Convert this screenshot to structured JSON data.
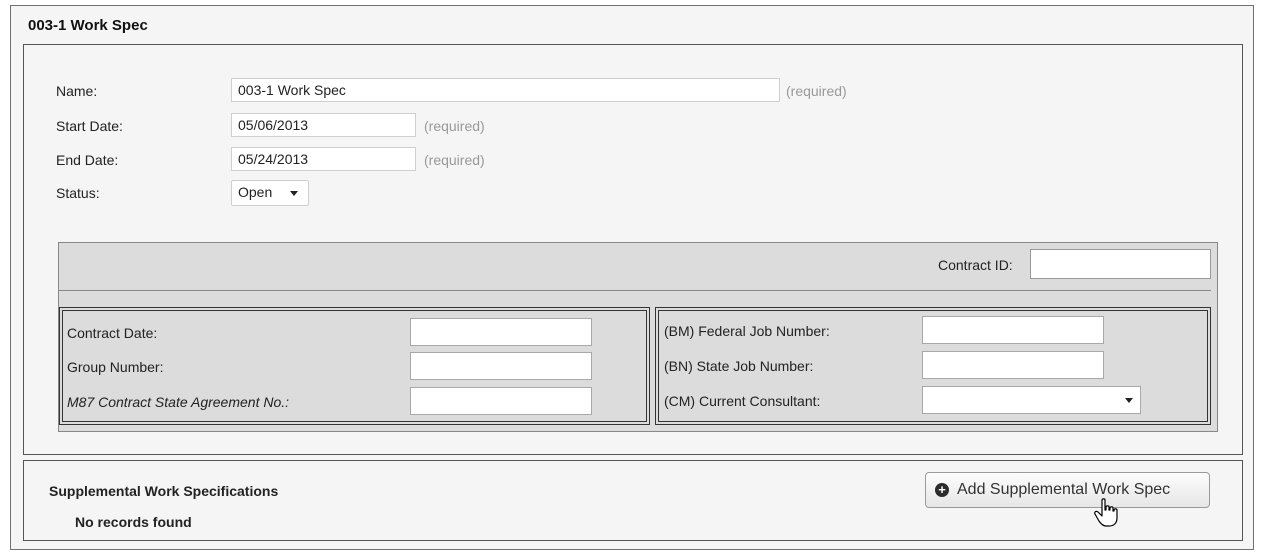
{
  "form": {
    "title": "003-1 Work Spec",
    "name_label": "Name:",
    "name_value": "003-1 Work Spec",
    "name_required": "(required)",
    "start_date_label": "Start Date:",
    "start_date_value": "05/06/2013",
    "start_date_required": "(required)",
    "end_date_label": "End Date:",
    "end_date_value": "05/24/2013",
    "end_date_required": "(required)",
    "status_label": "Status:",
    "status_value": "Open"
  },
  "contract": {
    "contract_id_label": "Contract ID:",
    "contract_id_value": "",
    "left": {
      "contract_date_label": "Contract Date:",
      "group_number_label": "Group Number:",
      "m87_label": "M87 Contract State Agreement No.:"
    },
    "right": {
      "federal_job_label": "(BM) Federal Job Number:",
      "state_job_label": "(BN) State Job Number:",
      "consultant_label": "(CM) Current Consultant:",
      "consultant_value": ""
    }
  },
  "supplemental": {
    "heading": "Supplemental Work Specifications",
    "empty_text": "No records found",
    "add_button_label": "Add Supplemental Work Spec"
  }
}
